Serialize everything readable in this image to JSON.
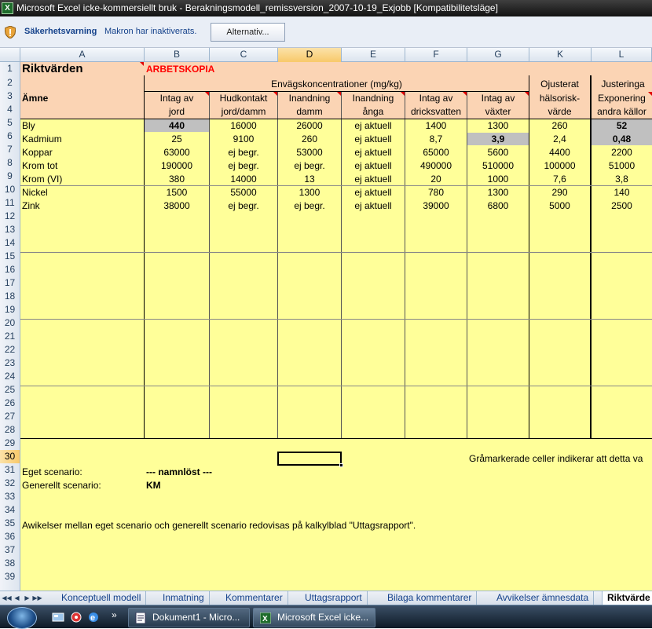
{
  "window": {
    "title": "Microsoft Excel icke-kommersiellt bruk - Berakningsmodell_remissversion_2007-10-19_Exjobb  [Kompatibilitetsläge]"
  },
  "security": {
    "label": "Säkerhetsvarning",
    "message": "Makron har inaktiverats.",
    "button": "Alternativ..."
  },
  "columns": [
    "A",
    "B",
    "C",
    "D",
    "E",
    "F",
    "G",
    "K",
    "L"
  ],
  "rows": [
    "1",
    "2",
    "3",
    "4",
    "5",
    "6",
    "7",
    "8",
    "9",
    "10",
    "11",
    "12",
    "13",
    "14",
    "15",
    "16",
    "17",
    "18",
    "19",
    "20",
    "21",
    "22",
    "23",
    "24",
    "25",
    "26",
    "27",
    "28",
    "29",
    "30",
    "31",
    "32",
    "33",
    "34",
    "35",
    "36",
    "37",
    "38",
    "39"
  ],
  "sheet": {
    "title": "Riktvärden",
    "stamp": "ARBETSKOPIA",
    "group_header": "Envägskoncentrationer (mg/kg)",
    "ojusterat": "Ojusterat",
    "justering": "Justeringa",
    "amne": "Ämne",
    "headers": [
      {
        "l1": "Intag av",
        "l2": "jord"
      },
      {
        "l1": "Hudkontakt",
        "l2": "jord/damm"
      },
      {
        "l1": "Inandning",
        "l2": "damm"
      },
      {
        "l1": "Inandning",
        "l2": "ånga"
      },
      {
        "l1": "Intag av",
        "l2": "dricksvatten"
      },
      {
        "l1": "Intag av",
        "l2": "växter"
      },
      {
        "l1": "hälsorisk-",
        "l2": "värde"
      },
      {
        "l1": "Exponering",
        "l2": "andra källor"
      }
    ],
    "data": [
      {
        "name": "Bly",
        "vals": [
          "440",
          "16000",
          "26000",
          "ej aktuell",
          "1400",
          "1300",
          "260",
          "52"
        ]
      },
      {
        "name": "Kadmium",
        "vals": [
          "25",
          "9100",
          "260",
          "ej aktuell",
          "8,7",
          "3,9",
          "2,4",
          "0,48"
        ]
      },
      {
        "name": "Koppar",
        "vals": [
          "63000",
          "ej begr.",
          "53000",
          "ej aktuell",
          "65000",
          "5600",
          "4400",
          "2200"
        ]
      },
      {
        "name": "Krom tot",
        "vals": [
          "190000",
          "ej begr.",
          "ej begr.",
          "ej aktuell",
          "490000",
          "510000",
          "100000",
          "51000"
        ]
      },
      {
        "name": "Krom (VI)",
        "vals": [
          "380",
          "14000",
          "13",
          "ej aktuell",
          "20",
          "1000",
          "7,6",
          "3,8"
        ]
      },
      {
        "name": "Nickel",
        "vals": [
          "1500",
          "55000",
          "1300",
          "ej aktuell",
          "780",
          "1300",
          "290",
          "140"
        ]
      },
      {
        "name": "Zink",
        "vals": [
          "38000",
          "ej begr.",
          "ej begr.",
          "ej aktuell",
          "39000",
          "6800",
          "5000",
          "2500"
        ]
      }
    ],
    "note_gray": "Gråmarkerade celler indikerar att detta va",
    "eget_label": "Eget scenario:",
    "eget_value": "--- namnlöst ---",
    "gen_label": "Generellt scenario:",
    "gen_value": "KM",
    "footer_note": "Awikelser mellan eget scenario och generellt scenario redovisas på kalkylblad \"Uttagsrapport\"."
  },
  "tabs": [
    "Konceptuell modell",
    "Inmatning",
    "Kommentarer",
    "Uttagsrapport",
    "Bilaga kommentarer",
    "Avvikelser ämnesdata",
    "Riktvärde"
  ],
  "taskbar": {
    "tasks": [
      "Dokument1 - Micro...",
      "Microsoft Excel icke..."
    ]
  }
}
